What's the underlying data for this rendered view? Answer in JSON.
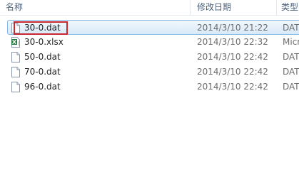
{
  "columns": {
    "name": "名称",
    "date": "修改日期",
    "type": "类型"
  },
  "files": [
    {
      "name": "30-0.dat",
      "date": "2014/3/10 21:22",
      "type": "DAT",
      "icon": "document-icon",
      "selected": true
    },
    {
      "name": "30-0.xlsx",
      "date": "2014/3/10 22:32",
      "type": "Micr",
      "icon": "excel-icon",
      "selected": false
    },
    {
      "name": "50-0.dat",
      "date": "2014/3/10 22:42",
      "type": "DAT",
      "icon": "document-icon",
      "selected": false
    },
    {
      "name": "70-0.dat",
      "date": "2014/3/10 22:42",
      "type": "DAT",
      "icon": "document-icon",
      "selected": false
    },
    {
      "name": "96-0.dat",
      "date": "2014/3/10 22:42",
      "type": "DAT",
      "icon": "document-icon",
      "selected": false
    }
  ],
  "colors": {
    "selection_border": "#89b7e6",
    "annotation_box": "#c8282e",
    "excel_green": "#1f7a3a"
  }
}
